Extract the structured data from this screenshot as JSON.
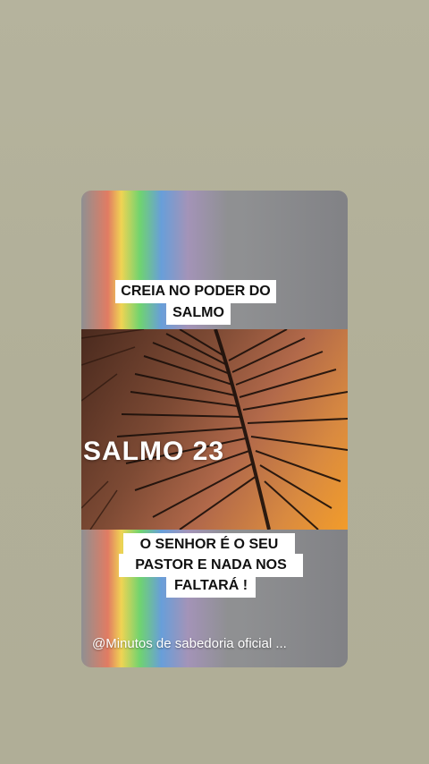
{
  "card": {
    "caption_top_line1": "CREIA NO PODER DO",
    "caption_top_line2": "SALMO",
    "video_title": "SALMO 23",
    "caption_bottom_line1": "O SENHOR É O SEU",
    "caption_bottom_line2": "PASTOR E NADA NOS",
    "caption_bottom_line3": "FALTARÁ !",
    "watermark": "@Minutos de sabedoria oficial ..."
  },
  "colors": {
    "page_background": "#b2b09a",
    "card_gray": "#8f9092",
    "caption_background": "#ffffff",
    "sunset_orange": "#f29c2a"
  },
  "icons": [
    "palm-leaf-graphic"
  ]
}
